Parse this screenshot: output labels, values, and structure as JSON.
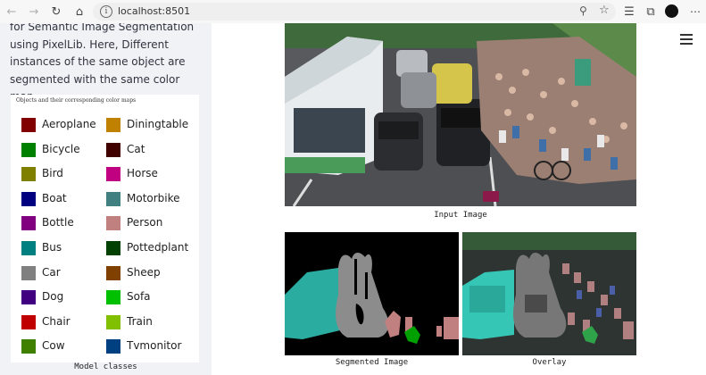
{
  "browser": {
    "url": "localhost:8501"
  },
  "sidebar": {
    "description": "for Semantic Image Segmentation using PixelLib. Here, Different instances of the same object are segmented with the same color map.",
    "legend_caption": "Objects and their corresponding color maps",
    "classes_left": [
      {
        "label": "Aeroplane",
        "color": "#800000"
      },
      {
        "label": "Bicycle",
        "color": "#008000"
      },
      {
        "label": "Bird",
        "color": "#808000"
      },
      {
        "label": "Boat",
        "color": "#000080"
      },
      {
        "label": "Bottle",
        "color": "#800080"
      },
      {
        "label": "Bus",
        "color": "#008080"
      },
      {
        "label": "Car",
        "color": "#808080"
      },
      {
        "label": "Dog",
        "color": "#400080"
      },
      {
        "label": "Chair",
        "color": "#c00000"
      },
      {
        "label": "Cow",
        "color": "#408000"
      }
    ],
    "classes_right": [
      {
        "label": "Diningtable",
        "color": "#c08000"
      },
      {
        "label": "Cat",
        "color": "#400000"
      },
      {
        "label": "Horse",
        "color": "#c00080"
      },
      {
        "label": "Motorbike",
        "color": "#408080"
      },
      {
        "label": "Person",
        "color": "#c08080"
      },
      {
        "label": "Pottedplant",
        "color": "#004000"
      },
      {
        "label": "Sheep",
        "color": "#804000"
      },
      {
        "label": "Sofa",
        "color": "#00c000"
      },
      {
        "label": "Train",
        "color": "#80c000"
      },
      {
        "label": "Tvmonitor",
        "color": "#004080"
      }
    ],
    "model_caption": "Model classes"
  },
  "main": {
    "input_caption": "Input Image",
    "segmented_caption": "Segmented Image",
    "overlay_caption": "Overlay"
  }
}
